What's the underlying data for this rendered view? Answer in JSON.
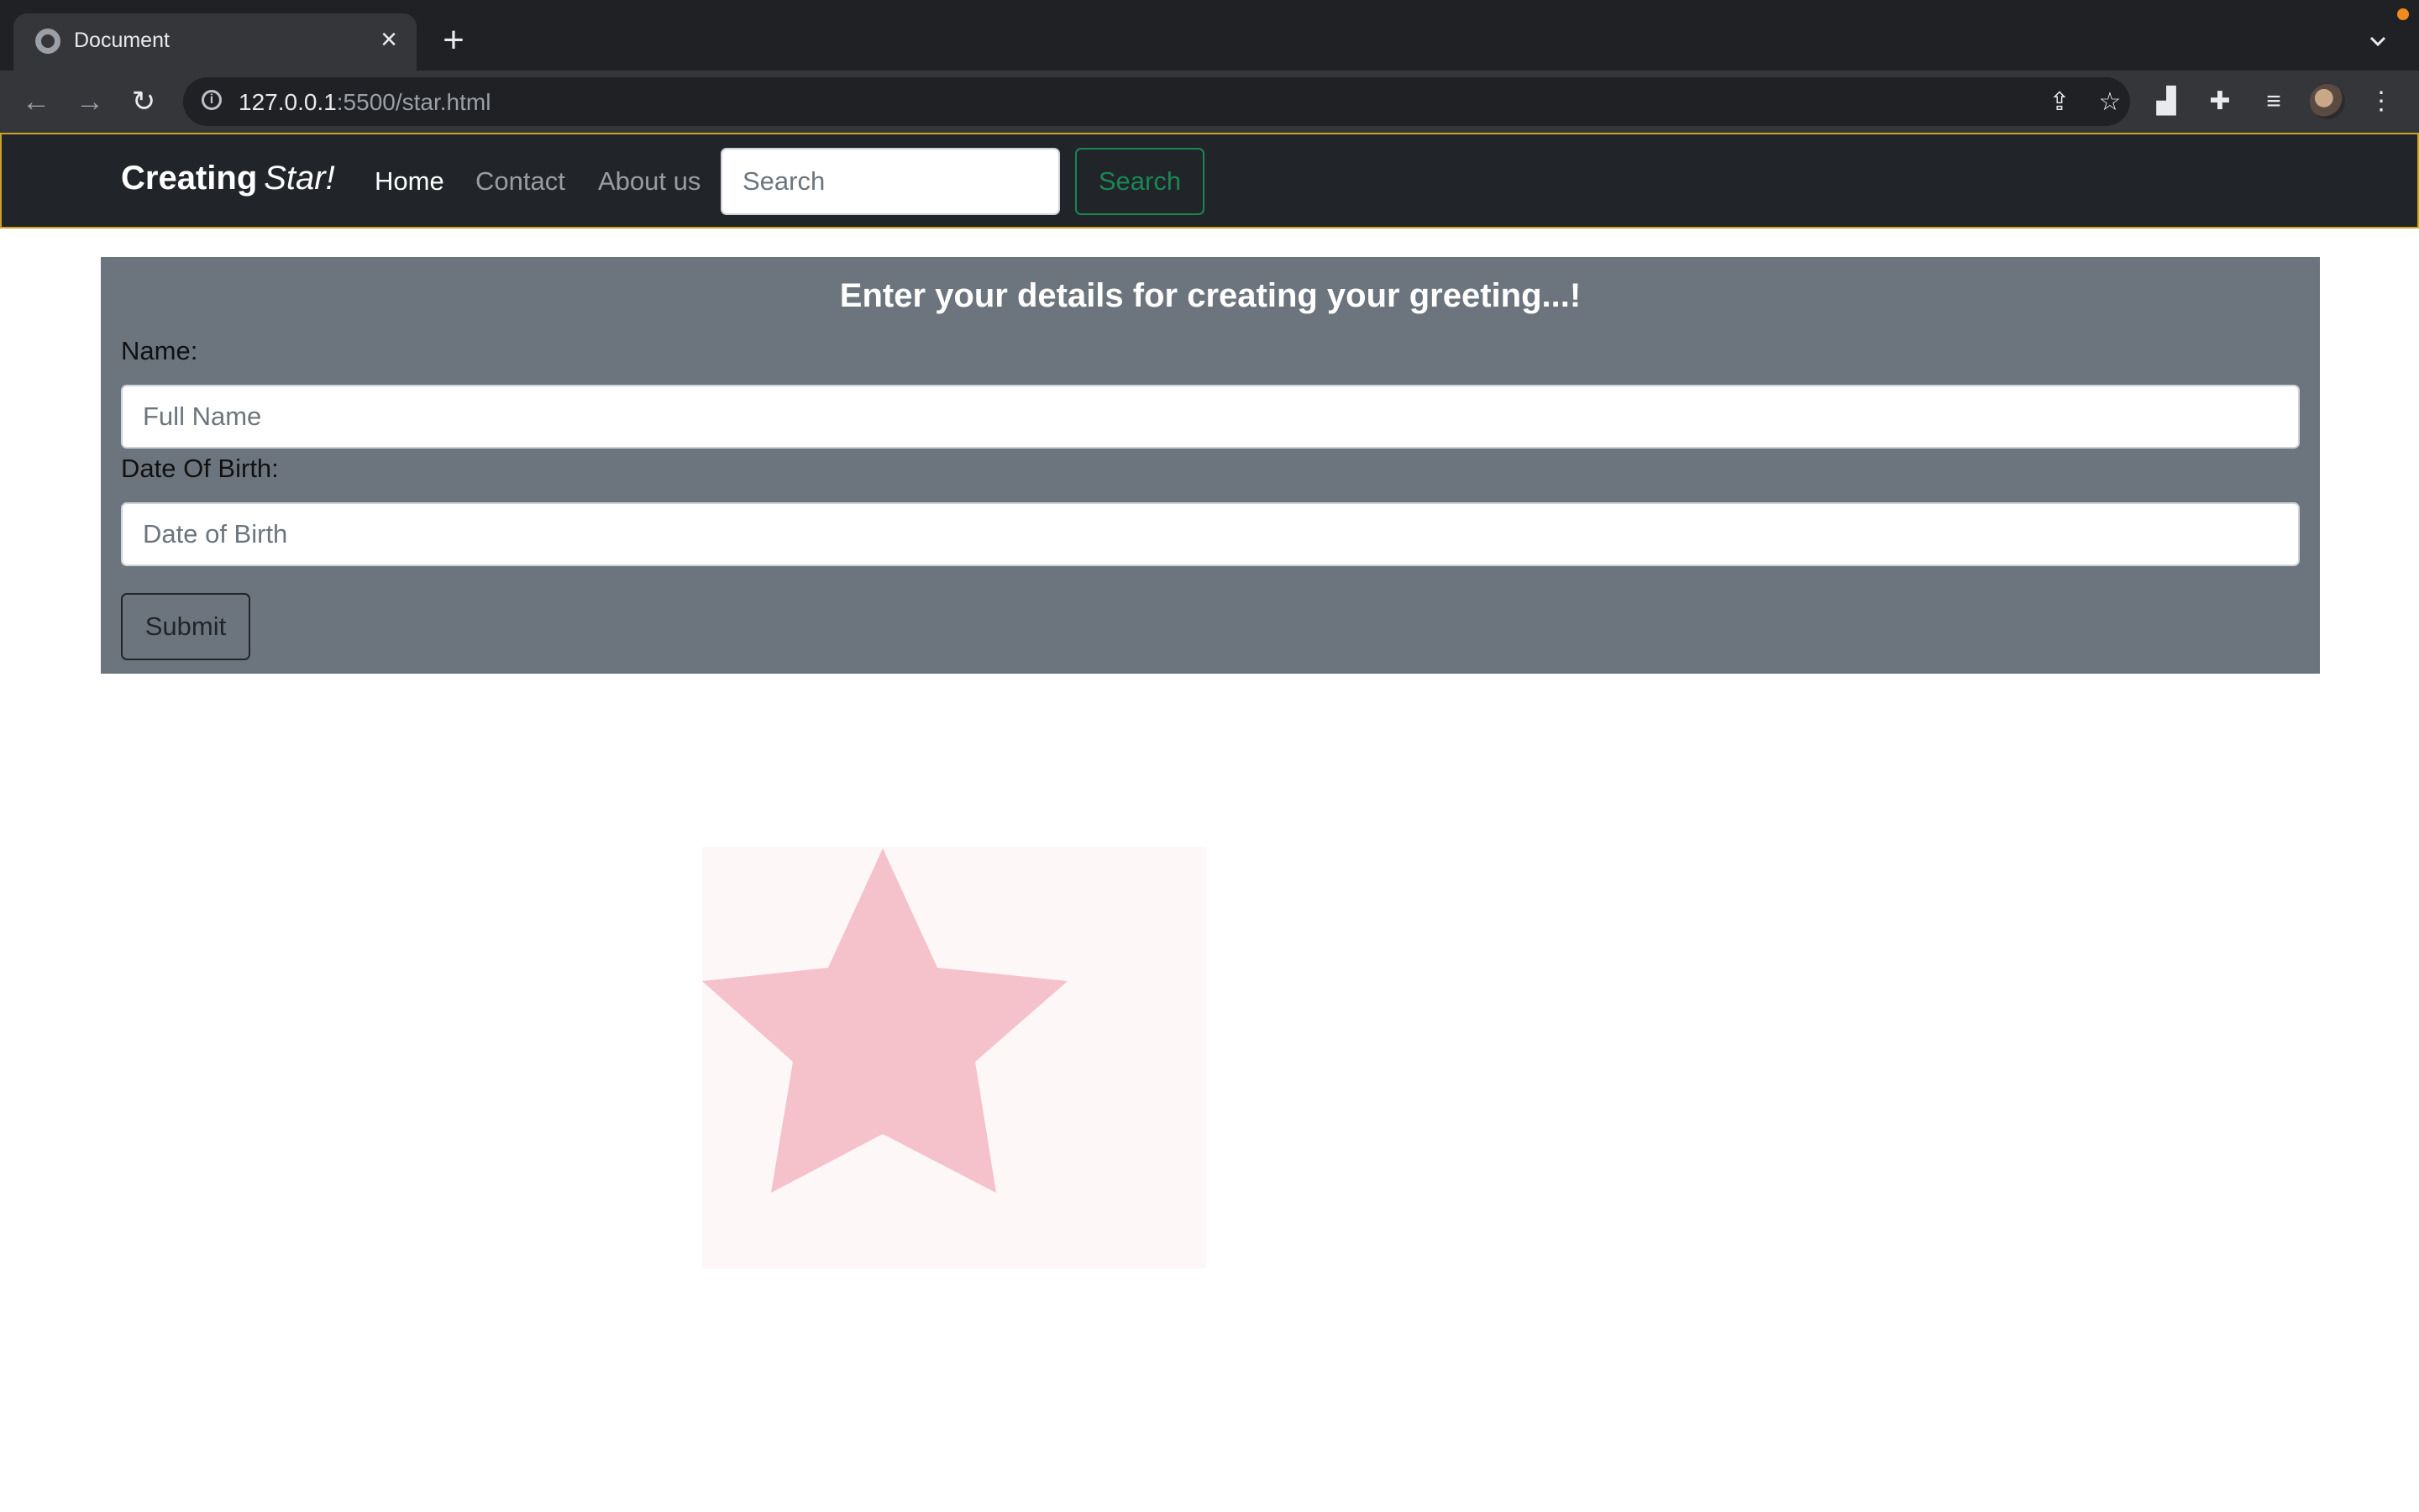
{
  "browser": {
    "tab_title": "Document",
    "url_host": "127.0.0.1",
    "url_rest": ":5500/star.html"
  },
  "navbar": {
    "brand": "Creating",
    "brand_em": "Star!",
    "links": [
      "Home",
      "Contact",
      "About us"
    ],
    "search_placeholder": "Search",
    "search_button": "Search"
  },
  "form": {
    "heading": "Enter your details for creating your greeting...!",
    "name_label": "Name:",
    "name_placeholder": "Full Name",
    "dob_label": "Date Of Birth:",
    "dob_placeholder": "Date of Birth",
    "submit_label": "Submit"
  },
  "colors": {
    "navbar_bg": "#212529",
    "panel_bg": "#6c757d",
    "accent_green": "#198754",
    "star_fill": "#f5c1cb"
  }
}
